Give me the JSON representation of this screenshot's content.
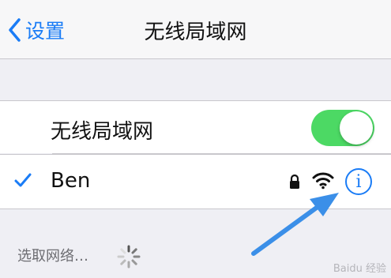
{
  "colors": {
    "accent": "#1a7cf6",
    "toggle_on": "#4cd964",
    "annotation_arrow": "#3b8fe8"
  },
  "navbar": {
    "back_label": "设置",
    "title": "无线局域网"
  },
  "wifi_toggle": {
    "label": "无线局域网",
    "enabled": true
  },
  "connected_network": {
    "name": "Ben",
    "selected": true,
    "secured": true,
    "icons": [
      "checkmark-icon",
      "lock-icon",
      "wifi-signal-icon",
      "info-icon"
    ]
  },
  "info_button": {
    "glyph": "i"
  },
  "network_list": {
    "header": "选取网络…",
    "loading": true
  },
  "watermark": "Baidu 经验"
}
